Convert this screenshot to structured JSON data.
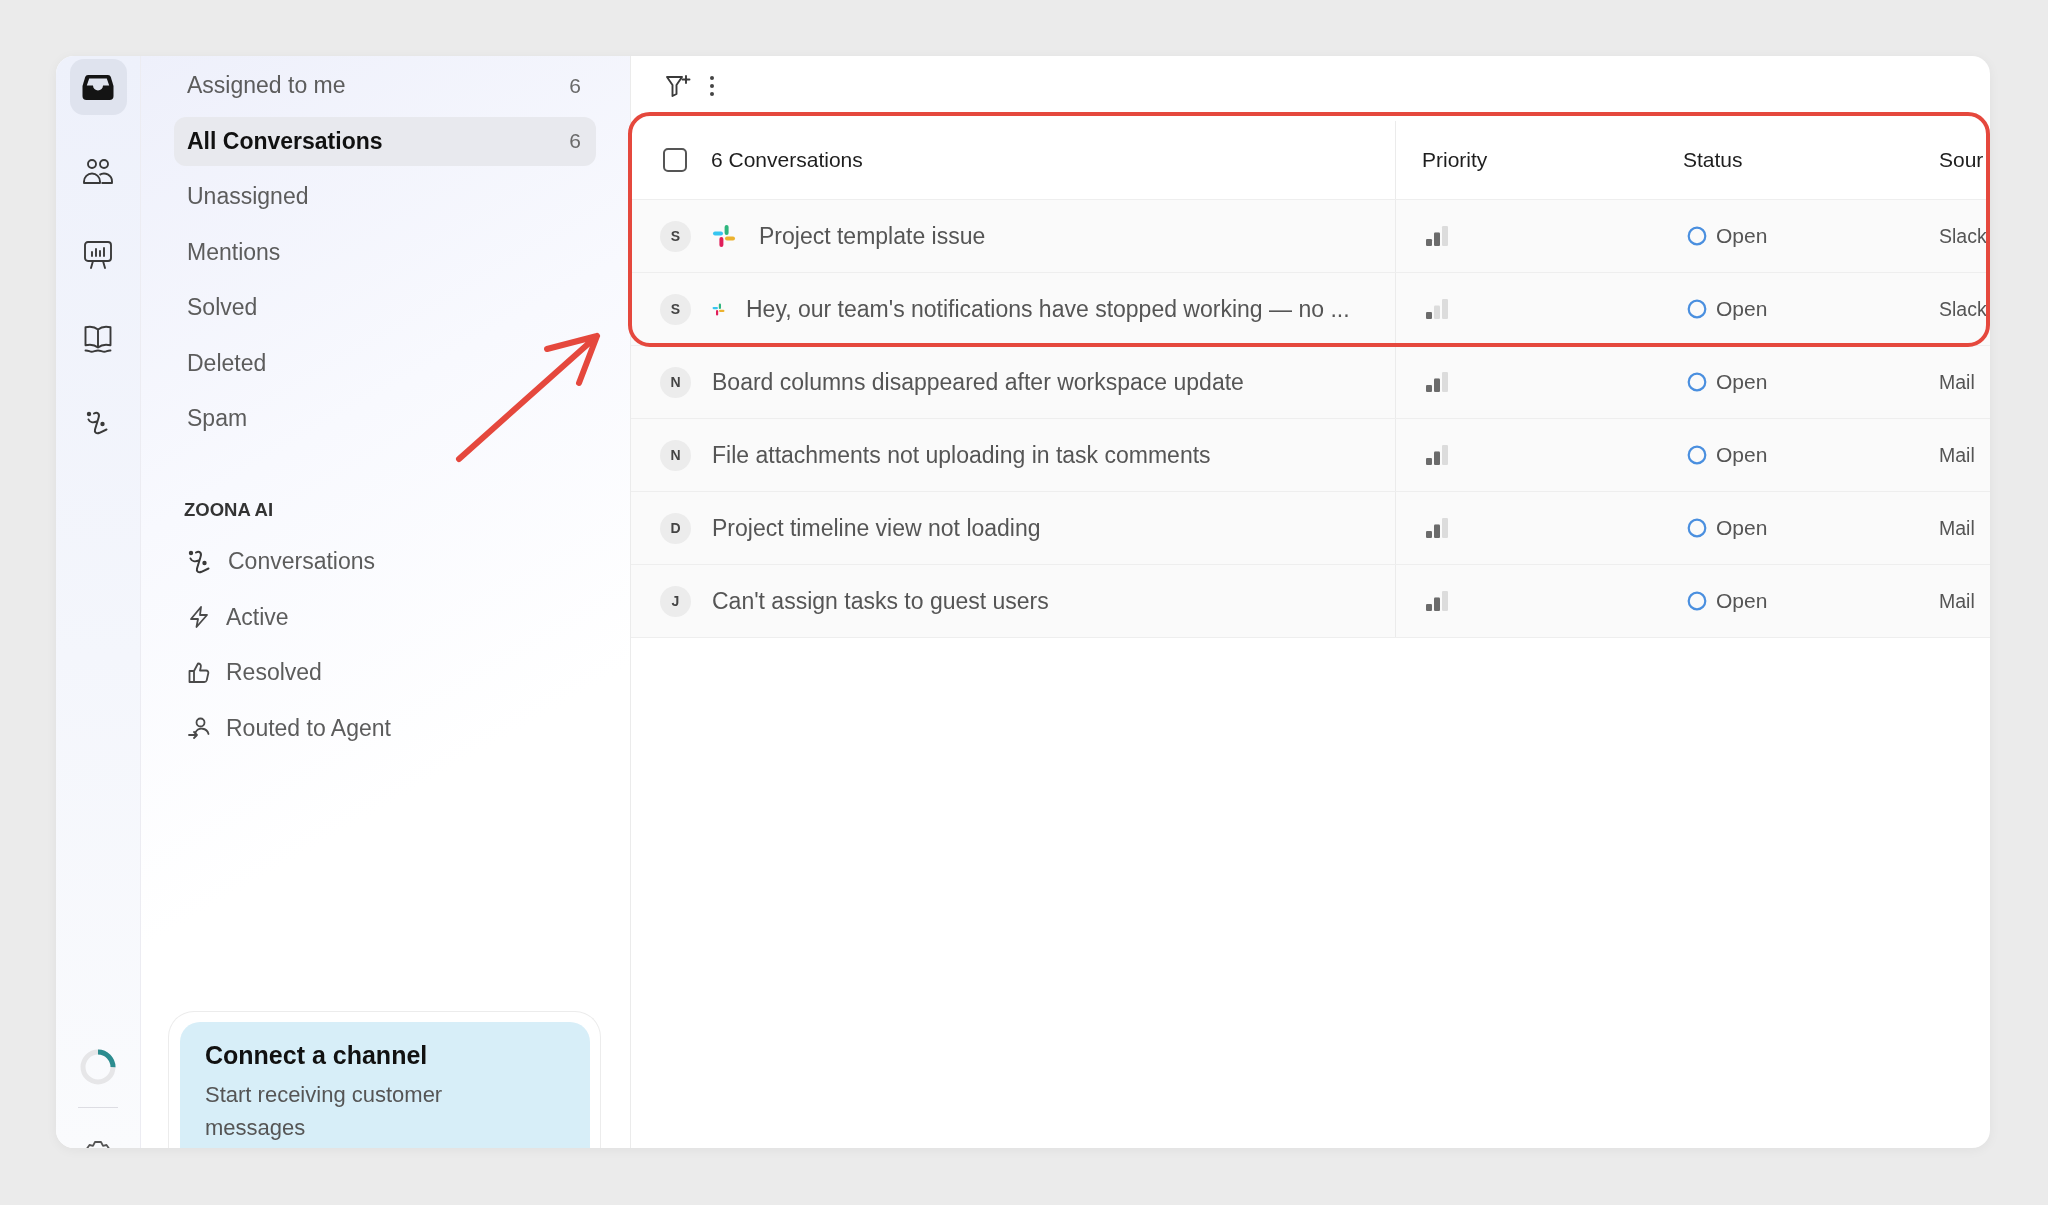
{
  "rail": {
    "items": [
      {
        "selected": true
      },
      {
        "selected": false
      },
      {
        "selected": false
      },
      {
        "selected": false
      },
      {
        "selected": false
      }
    ],
    "progress": {
      "level": 0.25
    }
  },
  "sidebar": {
    "views": [
      {
        "label": "Assigned to me",
        "count": "6",
        "selected": false
      },
      {
        "label": "All Conversations",
        "count": "6",
        "selected": true
      },
      {
        "label": "Unassigned",
        "selected": false
      },
      {
        "label": "Mentions",
        "selected": false
      },
      {
        "label": "Solved",
        "selected": false
      },
      {
        "label": "Deleted",
        "selected": false
      },
      {
        "label": "Spam",
        "selected": false
      }
    ],
    "ai_section": {
      "title": "ZOONA AI",
      "items": [
        {
          "label": "Conversations"
        },
        {
          "label": "Active"
        },
        {
          "label": "Resolved"
        },
        {
          "label": "Routed to Agent"
        }
      ]
    },
    "promo": {
      "title": "Connect a channel",
      "text": "Start receiving customer messages"
    }
  },
  "table": {
    "select_all": {
      "checked": false
    },
    "columns": [
      {
        "label": "6 Conversations"
      },
      {
        "label": "Priority"
      },
      {
        "label": "Status"
      },
      {
        "label": "Sour"
      }
    ],
    "rows": [
      {
        "kind": "branded",
        "initial": "S",
        "title": "Project template issue",
        "level": 0.67,
        "status": "Open",
        "column_4": "Slack"
      },
      {
        "kind": "compact",
        "initial": "S",
        "title": "Hey, our team's notifications have stopped working — no ...",
        "level": 0.33,
        "status": "Open",
        "column_4": "Slack"
      },
      {
        "kind": "plain",
        "initial": "N",
        "title": "Board columns disappeared after workspace update",
        "level": 0.67,
        "status": "Open",
        "column_4": "Mail"
      },
      {
        "kind": "plain",
        "initial": "N",
        "title": "File attachments not uploading in task comments",
        "level": 0.67,
        "status": "Open",
        "column_4": "Mail"
      },
      {
        "kind": "plain",
        "initial": "D",
        "title": "Project timeline view not loading",
        "level": 0.67,
        "status": "Open",
        "column_4": "Mail"
      },
      {
        "kind": "plain",
        "initial": "J",
        "title": "Can't assign tasks to guest users",
        "level": 0.67,
        "status": "Open",
        "column_4": "Mail"
      }
    ]
  }
}
